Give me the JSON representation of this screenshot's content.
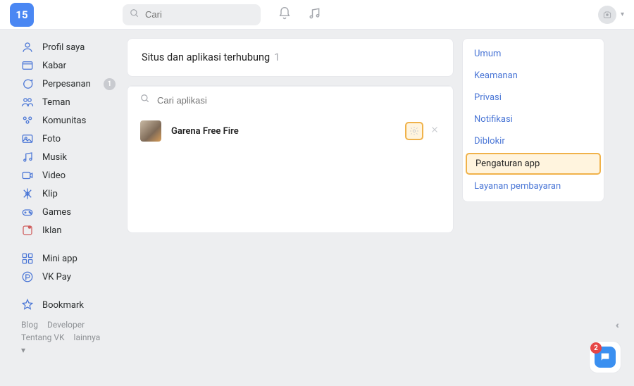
{
  "header": {
    "logo_text": "15",
    "search_placeholder": "Cari"
  },
  "sidebar": {
    "items": [
      {
        "label": "Profil saya",
        "icon": "profile"
      },
      {
        "label": "Kabar",
        "icon": "news"
      },
      {
        "label": "Perpesanan",
        "icon": "messages",
        "badge": "1"
      },
      {
        "label": "Teman",
        "icon": "friends"
      },
      {
        "label": "Komunitas",
        "icon": "community"
      },
      {
        "label": "Foto",
        "icon": "photo"
      },
      {
        "label": "Musik",
        "icon": "music"
      },
      {
        "label": "Video",
        "icon": "video"
      },
      {
        "label": "Klip",
        "icon": "clip"
      },
      {
        "label": "Games",
        "icon": "games"
      },
      {
        "label": "Iklan",
        "icon": "ad"
      }
    ],
    "secondary": [
      {
        "label": "Mini app",
        "icon": "miniapp"
      },
      {
        "label": "VK Pay",
        "icon": "vkpay"
      }
    ],
    "tertiary": [
      {
        "label": "Bookmark",
        "icon": "bookmark"
      }
    ],
    "footer": {
      "links_row1": [
        "Blog",
        "Developer"
      ],
      "links_row2": [
        "Tentang VK",
        "lainnya"
      ]
    }
  },
  "main": {
    "title": "Situs dan aplikasi terhubung",
    "title_count": "1",
    "search_placeholder": "Cari aplikasi",
    "apps": [
      {
        "name": "Garena Free Fire"
      }
    ]
  },
  "settings_menu": {
    "items": [
      {
        "label": "Umum",
        "active": false
      },
      {
        "label": "Keamanan",
        "active": false
      },
      {
        "label": "Privasi",
        "active": false
      },
      {
        "label": "Notifikasi",
        "active": false
      },
      {
        "label": "Diblokir",
        "active": false
      },
      {
        "label": "Pengaturan app",
        "active": true
      },
      {
        "label": "Layanan pembayaran",
        "active": false
      }
    ]
  },
  "chat": {
    "badge": "2"
  }
}
